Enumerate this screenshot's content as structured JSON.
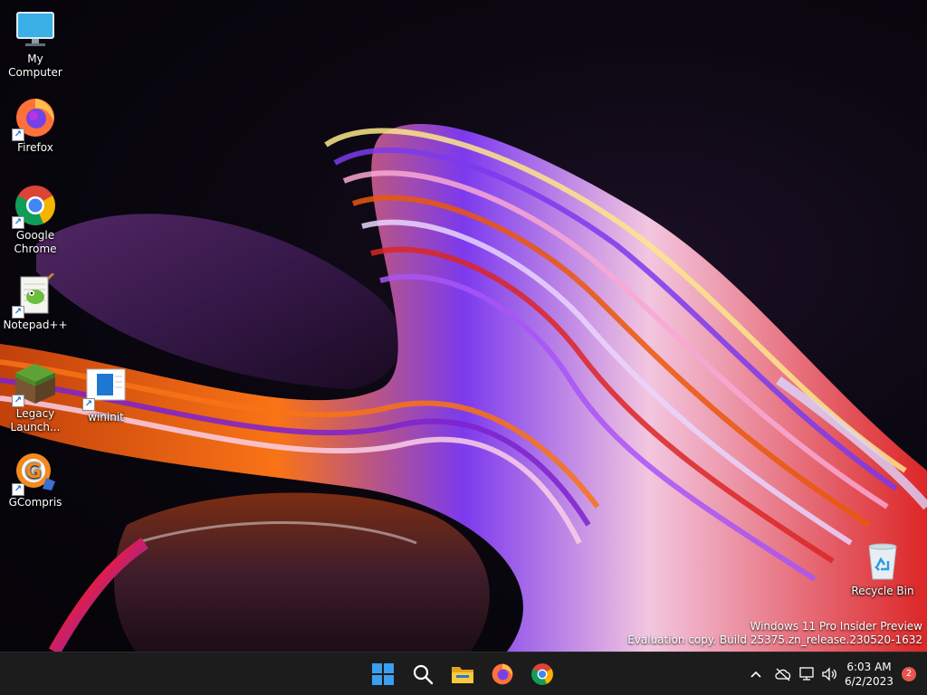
{
  "desktop": {
    "icons": [
      {
        "label": "My Computer",
        "icon": "monitor-icon",
        "shortcut": false
      },
      {
        "label": "Firefox",
        "icon": "firefox-icon",
        "shortcut": true
      },
      {
        "label": "Google Chrome",
        "icon": "chrome-icon",
        "shortcut": true
      },
      {
        "label": "Notepad++",
        "icon": "notepadpp-icon",
        "shortcut": true
      },
      {
        "label": "Legacy Launch...",
        "icon": "minecraft-icon",
        "shortcut": true
      },
      {
        "label": "wininit",
        "icon": "wininit-icon",
        "shortcut": true
      },
      {
        "label": "GCompris",
        "icon": "gcompris-icon",
        "shortcut": true
      },
      {
        "label": "Recycle Bin",
        "icon": "recycle-bin-icon",
        "shortcut": false
      }
    ],
    "watermark": {
      "line1": "Windows 11 Pro Insider Preview",
      "line2": "Evaluation copy. Build 25375.zn_release.230520-1632"
    }
  },
  "taskbar": {
    "pinned": [
      "start-icon",
      "search-icon",
      "file-explorer-icon",
      "firefox-icon",
      "chrome-icon"
    ],
    "tray": {
      "time": "6:03 AM",
      "date": "6/2/2023",
      "notification_count": "2"
    }
  },
  "colors": {
    "taskbar_bg": "#1c1c1c",
    "start_blue": "#3a9ff0",
    "notification_badge": "#e8554e"
  }
}
